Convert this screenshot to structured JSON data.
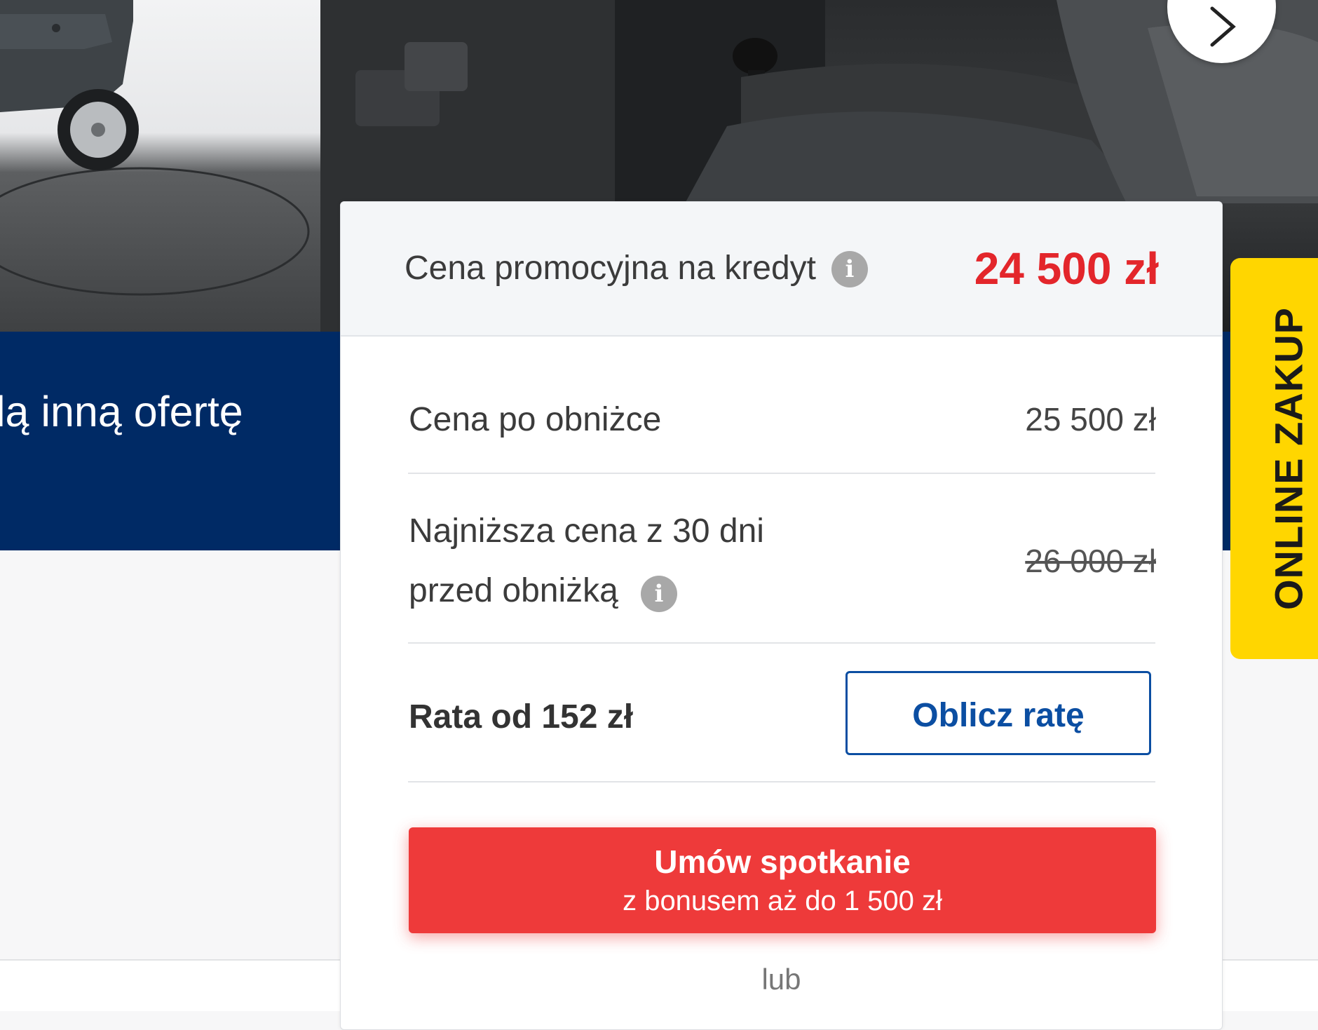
{
  "banner": {
    "text": "lą inną ofertę"
  },
  "gallery": {
    "next_icon": "chevron-right-icon"
  },
  "price_card": {
    "promo_label": "Cena promocyjna na kredyt",
    "promo_price": "24 500 zł",
    "after_reduction_label": "Cena po obniżce",
    "after_reduction_value": "25 500 zł",
    "lowest_label_line1": "Najniższa cena z 30 dni",
    "lowest_label_line2": "przed obniżką",
    "lowest_value": "26 000 zł",
    "rate_label": "Rata od 152 zł",
    "calc_button": "Oblicz ratę",
    "meeting_button_main": "Umów spotkanie",
    "meeting_button_sub": "z bonusem aż do 1 500 zł",
    "or_text": "lub",
    "info_icon": "info-icon"
  },
  "side_tab": {
    "label": "ONLINE ZAKUP"
  },
  "colors": {
    "brand_navy": "#002a65",
    "price_red": "#e3262b",
    "cta_red": "#ee3a3a",
    "link_blue": "#0b4ea2",
    "tab_yellow": "#ffd600"
  }
}
